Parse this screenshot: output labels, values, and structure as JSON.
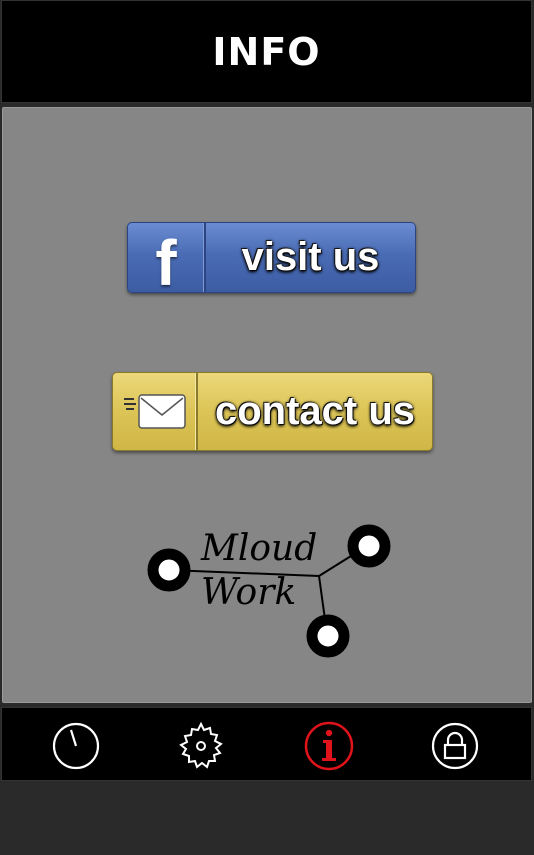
{
  "header": {
    "title": "INFO"
  },
  "buttons": {
    "facebook": {
      "icon": "facebook-icon",
      "glyph": "f",
      "label": "visit us"
    },
    "contact": {
      "icon": "envelope-icon",
      "label": "contact us"
    }
  },
  "logo": {
    "line1": "Mloud",
    "line2": "Work"
  },
  "navbar": {
    "items": [
      {
        "name": "timer",
        "icon": "stopwatch-icon",
        "active": false
      },
      {
        "name": "settings",
        "icon": "gear-icon",
        "active": false
      },
      {
        "name": "info",
        "icon": "info-icon",
        "active": true
      },
      {
        "name": "lock",
        "icon": "lock-icon",
        "active": false
      }
    ]
  },
  "colors": {
    "active": "#e0131a",
    "inactive": "#ffffff",
    "facebook_blue": "#4a6cb5",
    "contact_yellow": "#dcc456",
    "content_bg": "#868686"
  }
}
